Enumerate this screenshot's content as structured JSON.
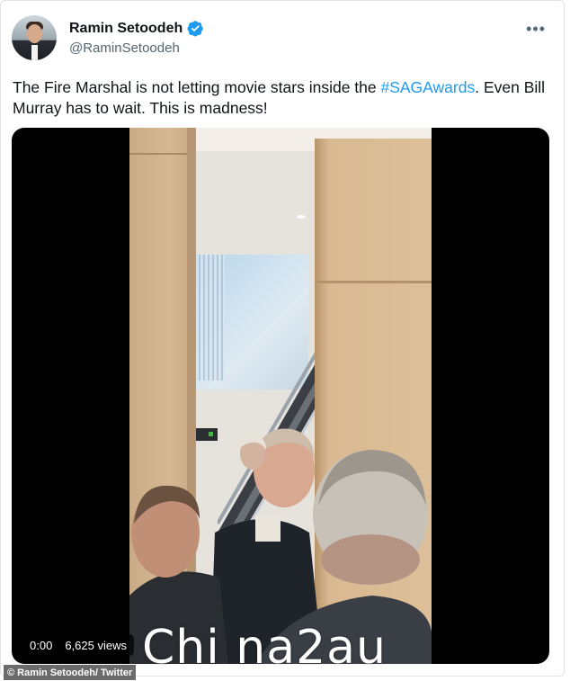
{
  "tweet": {
    "author": {
      "display_name": "Ramin Setoodeh",
      "handle": "@RaminSetoodeh",
      "verified": true,
      "verified_color": "#1d9bf0"
    },
    "more_icon": "more-horizontal-icon",
    "text_before_hashtag": "The Fire Marshal is not letting movie stars inside the ",
    "hashtag": "#SAGAwards",
    "text_after_hashtag": ". Even Bill Murray has to wait. This is madness!",
    "hashtag_color": "#1d9bf0"
  },
  "video": {
    "elapsed": "0:00",
    "views": "6,625 views"
  },
  "watermark": "Chi na2au",
  "credit": "© Ramin Setoodeh/ Twitter"
}
